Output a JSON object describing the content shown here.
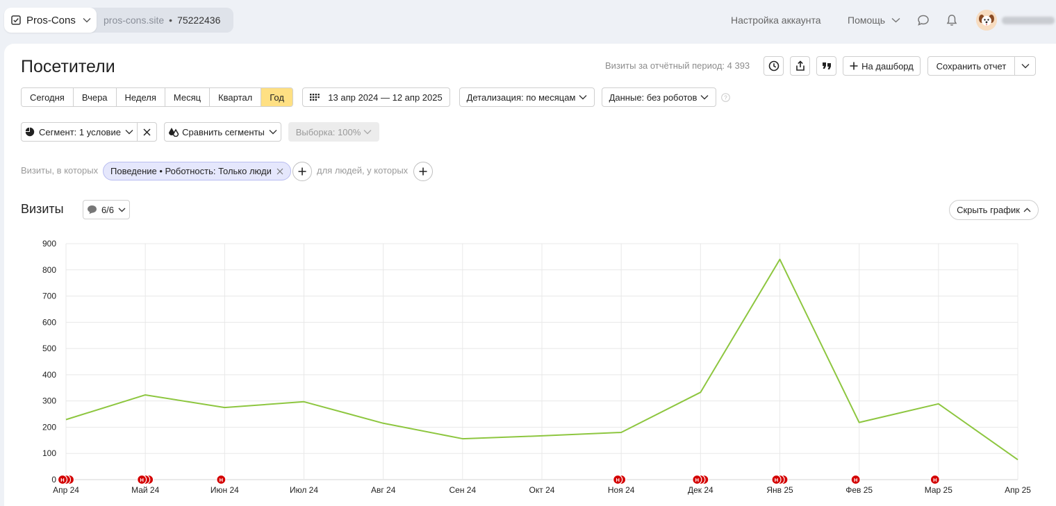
{
  "topbar": {
    "counter_name": "Pros-Cons",
    "site_domain": "pros-cons.site",
    "counter_id": "75222436",
    "account_settings": "Настройка аккаунта",
    "help": "Помощь"
  },
  "report": {
    "title": "Посетители",
    "visits_total_label": "Визиты за отчётный период: 4 393",
    "add_dashboard": "На дашборд",
    "save_report": "Сохранить отчет"
  },
  "periods": [
    "Сегодня",
    "Вчера",
    "Неделя",
    "Месяц",
    "Квартал",
    "Год"
  ],
  "active_period": "Год",
  "date_range": "13 апр 2024 — 12 апр 2025",
  "detail": "Детализация: по месяцам",
  "data_filter": "Данные: без роботов",
  "segment": "Сегмент: 1 условие",
  "compare_segments": "Сравнить сегменты",
  "sample": "Выборка: 100%",
  "filter": {
    "prefix": "Визиты, в которых",
    "chip": "Поведение • Роботность: Только люди",
    "people_prefix": "для людей, у которых"
  },
  "chart_section": {
    "title": "Визиты",
    "notes_count": "6/6",
    "hide_chart": "Скрыть график"
  },
  "colors": {
    "line": "#8dc63f",
    "marker": "#d40000",
    "active_period": "#ffe083",
    "chip_bg": "#e5e7fc"
  },
  "chart_data": {
    "type": "line",
    "categories": [
      "Апр 24",
      "Май 24",
      "Июн 24",
      "Июл 24",
      "Авг 24",
      "Сен 24",
      "Окт 24",
      "Ноя 24",
      "Дек 24",
      "Янв 25",
      "Фев 25",
      "Мар 25",
      "Апр 25"
    ],
    "series": [
      {
        "values": [
          229,
          323,
          275,
          297,
          215,
          156,
          167,
          180,
          333,
          840,
          218,
          289,
          76
        ]
      }
    ],
    "ylim": [
      0,
      900
    ],
    "yticks": [
      0,
      100,
      200,
      300,
      400,
      500,
      600,
      700,
      800,
      900
    ],
    "grid": true,
    "note_markers": [
      {
        "category": "Апр 24",
        "count": 3
      },
      {
        "category": "Май 24",
        "count": 3
      },
      {
        "category": "Июн 24",
        "count": 1
      },
      {
        "category": "Ноя 24",
        "count": 2
      },
      {
        "category": "Дек 24",
        "count": 3
      },
      {
        "category": "Янв 25",
        "count": 3
      },
      {
        "category": "Фев 25",
        "count": 1
      },
      {
        "category": "Мар 25",
        "count": 1
      }
    ],
    "marker_letter": "Н"
  }
}
